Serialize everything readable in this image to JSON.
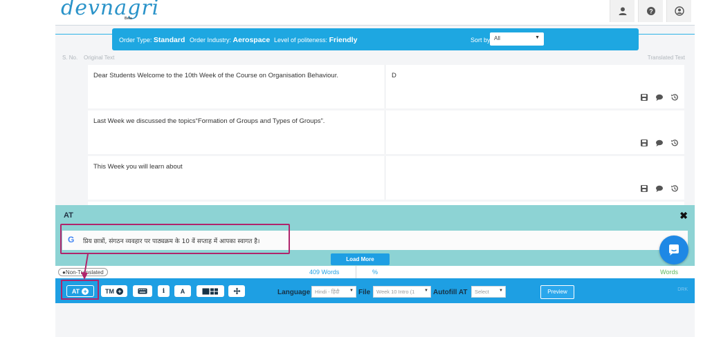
{
  "app": {
    "logo": "devnagri",
    "beta": "Beta"
  },
  "header_icons": [
    "user-icon",
    "help-icon",
    "account-icon"
  ],
  "order": {
    "type_label": "Order Type:",
    "type_value": "Standard",
    "industry_label": "Order Industry:",
    "industry_value": "Aerospace",
    "politeness_label": "Level of politeness:",
    "politeness_value": "Friendly",
    "sort_label": "Sort by",
    "sort_value": "All"
  },
  "columns": {
    "sno": "S. No.",
    "original": "Original Text",
    "translated": "Translated Text"
  },
  "rows": [
    {
      "source": "Dear Students Welcome to the 10th Week of the Course on Organisation Behaviour.",
      "target": "D"
    },
    {
      "source": "Last Week we discussed the topics“Formation of Groups and Types of Groups”.",
      "target": ""
    },
    {
      "source": "This Week you will learn about",
      "target": ""
    }
  ],
  "at_panel": {
    "title": "AT",
    "close": "✖",
    "suggestion_provider": "G",
    "suggestion": "प्रिय छात्रों, संगठन व्यवहार पर पाठ्यक्रम के 10 वें सप्ताह में आपका स्वागत है।",
    "load_more": "Load More"
  },
  "stats": {
    "badge": "Non-Translated",
    "words": "409 Words",
    "percent": "%",
    "words_right": "Words"
  },
  "toolbar": {
    "at_label": "AT",
    "tm_label": "TM",
    "info_label": "i",
    "font_label": "A",
    "language_label": "Language",
    "language_value": "Hindi - हिंदी",
    "file_label": "File",
    "file_value": "Week 10 Intro (1",
    "autofill_label": "Autofill AT",
    "autofill_value": "Select",
    "preview_label": "Preview",
    "corner_text": "DRK"
  },
  "colors": {
    "accent": "#1e9fe3",
    "panel": "#8dd3d4",
    "highlight": "#b0246b"
  }
}
